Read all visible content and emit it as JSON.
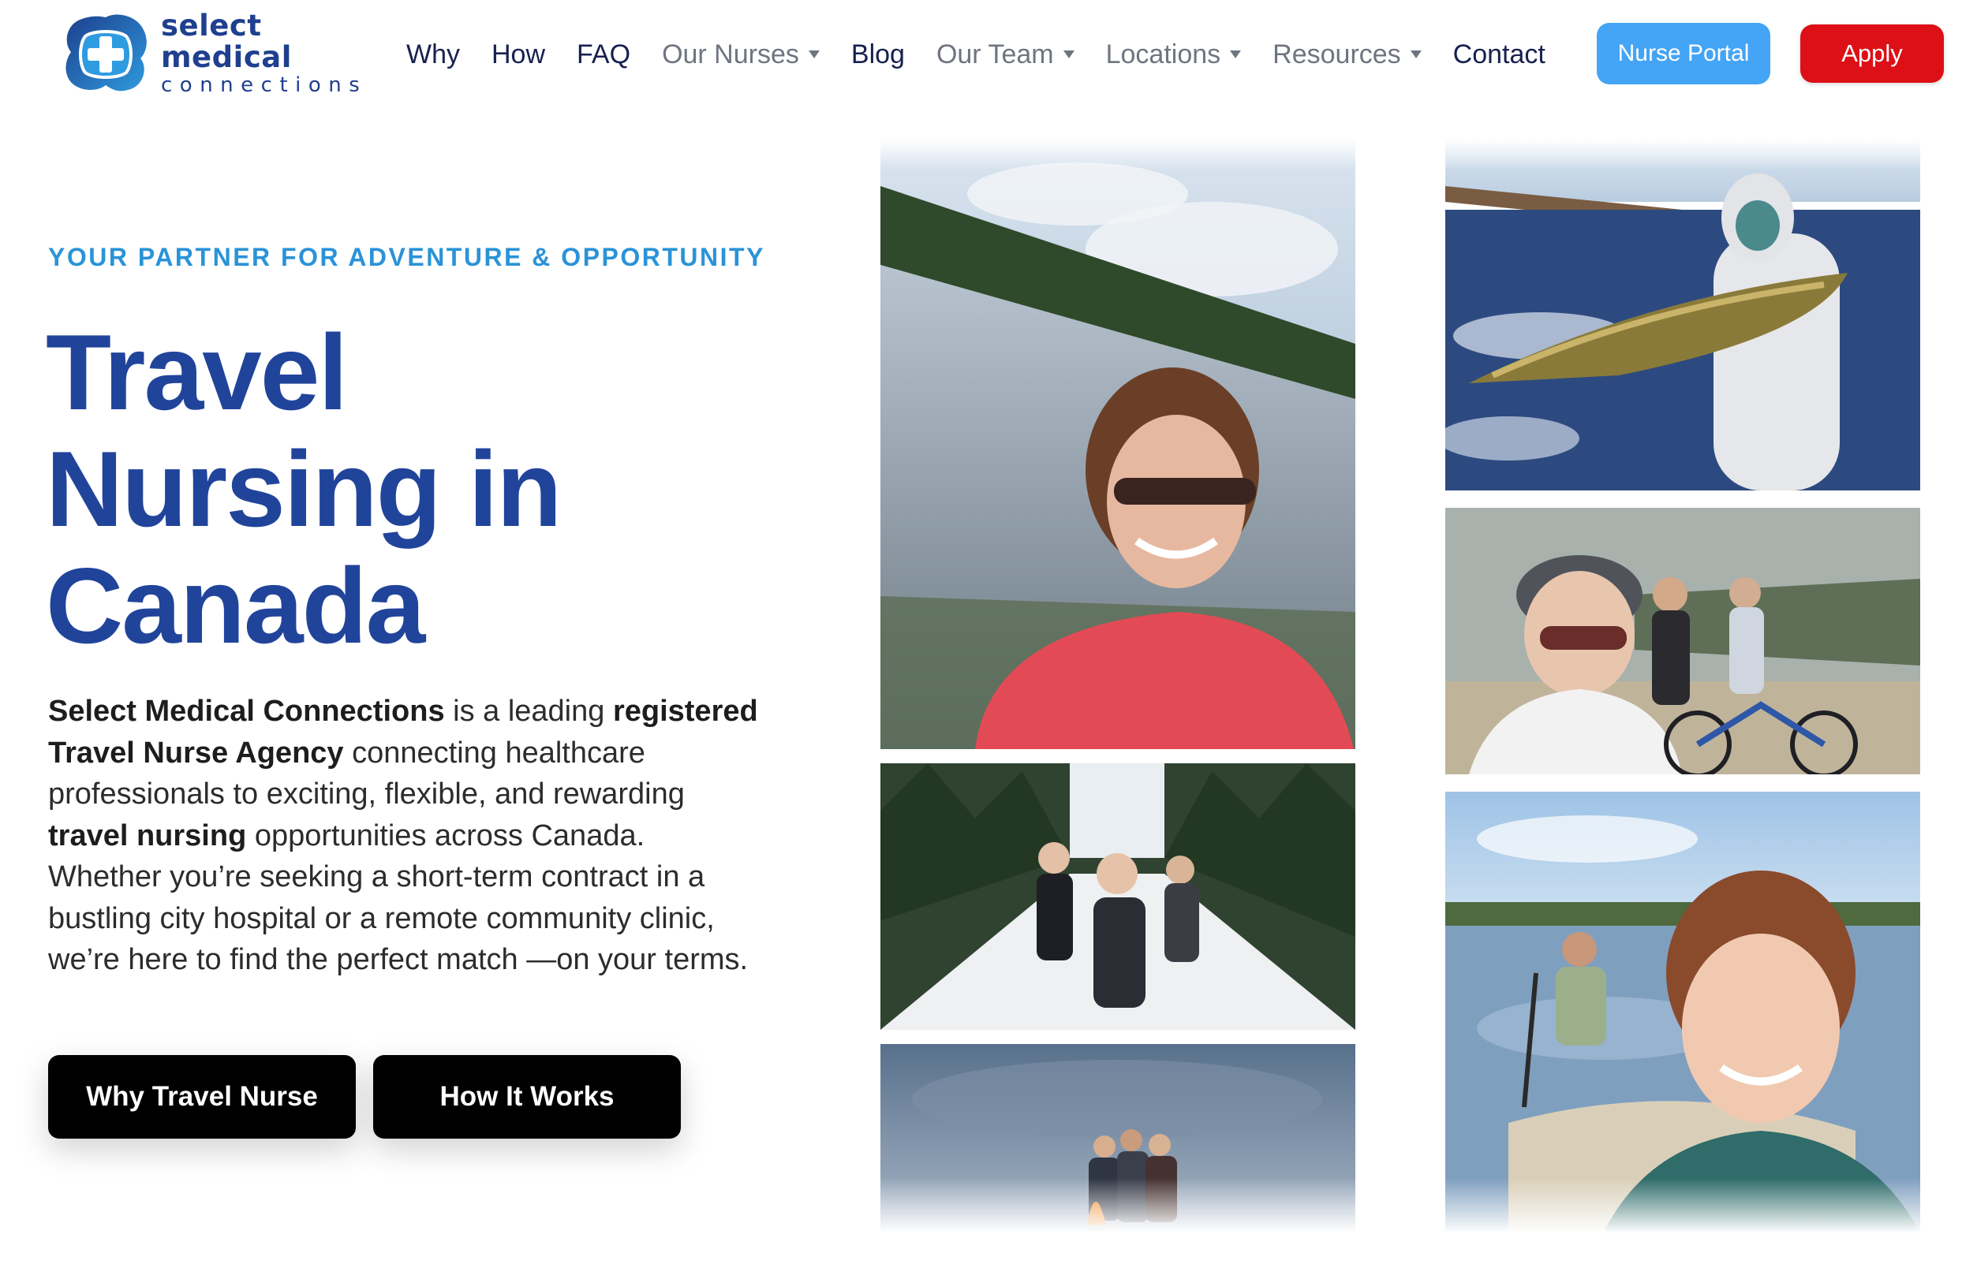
{
  "brand": {
    "name_line1": "select medical",
    "name_line2": "connections",
    "colors": {
      "navy": "#1f3f8f",
      "sky": "#44a4f5",
      "red": "#dc1016"
    }
  },
  "nav": {
    "items": [
      {
        "label": "Why",
        "dropdown": false
      },
      {
        "label": "How",
        "dropdown": false
      },
      {
        "label": "FAQ",
        "dropdown": false
      },
      {
        "label": "Our Nurses",
        "dropdown": true
      },
      {
        "label": "Blog",
        "dropdown": false
      },
      {
        "label": "Our Team",
        "dropdown": true
      },
      {
        "label": "Locations",
        "dropdown": true
      },
      {
        "label": "Resources",
        "dropdown": true
      },
      {
        "label": "Contact",
        "dropdown": false
      }
    ],
    "portal_label": "Nurse Portal",
    "apply_label": "Apply"
  },
  "hero": {
    "eyebrow": "YOUR PARTNER FOR ADVENTURE & OPPORTUNITY",
    "title_lines": [
      "Travel",
      "Nursing in",
      "Canada"
    ],
    "intro": {
      "bold1": "Select Medical Connections",
      "text1": " is a leading ",
      "bold2": "registered Travel Nurse Agency",
      "text2": " connecting healthcare professionals to exciting, flexible, and rewarding ",
      "bold3": "travel nursing",
      "text3": " opportunities across Canada. Whether you’re seeking a short-term contract in a bustling city hospital or a remote community clinic, we’re here to find the perfect match —on your terms."
    },
    "cta_primary": "Why Travel Nurse",
    "cta_secondary": "How It Works"
  },
  "gallery": {
    "photos": [
      {
        "name": "lake-selfie-photo"
      },
      {
        "name": "ski-trail-photo"
      },
      {
        "name": "campfire-photo"
      },
      {
        "name": "ice-fishing-pike-photo"
      },
      {
        "name": "cycling-group-photo"
      },
      {
        "name": "canoe-river-photo"
      }
    ]
  }
}
